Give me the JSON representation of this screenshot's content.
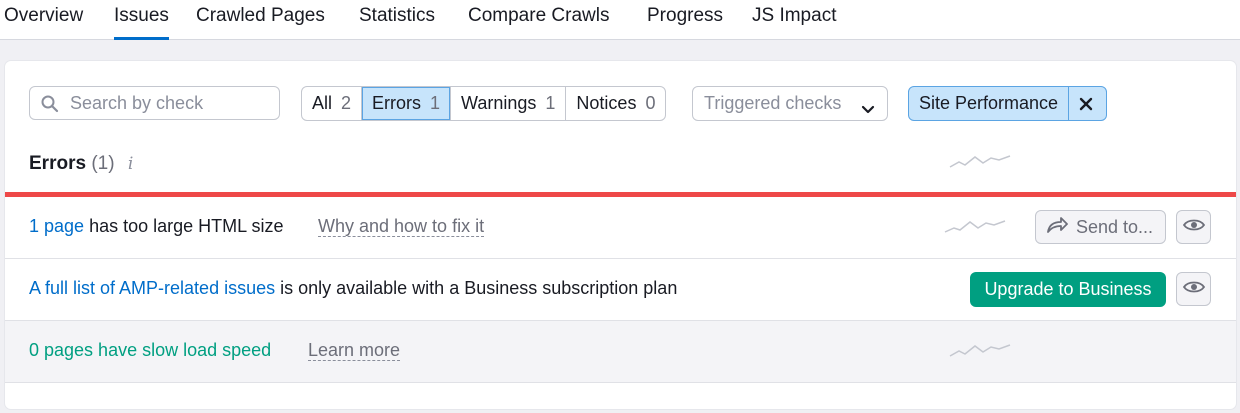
{
  "nav": {
    "tabs": [
      {
        "label": "Overview"
      },
      {
        "label": "Issues"
      },
      {
        "label": "Crawled Pages"
      },
      {
        "label": "Statistics"
      },
      {
        "label": "Compare Crawls"
      },
      {
        "label": "Progress"
      },
      {
        "label": "JS Impact"
      }
    ],
    "active": "Issues"
  },
  "filters": {
    "search_placeholder": "Search by check",
    "segments": [
      {
        "label": "All",
        "count": "2"
      },
      {
        "label": "Errors",
        "count": "1"
      },
      {
        "label": "Warnings",
        "count": "1"
      },
      {
        "label": "Notices",
        "count": "0"
      }
    ],
    "active_segment": "Errors",
    "dropdown_label": "Triggered checks",
    "chip_label": "Site Performance"
  },
  "section": {
    "title": "Errors",
    "count": "(1)",
    "info_glyph": "i"
  },
  "rows": [
    {
      "link": "1 page",
      "text": " has too large HTML size",
      "help": "Why and how to fix it",
      "action": "Send to..."
    },
    {
      "link": "A full list of AMP-related issues",
      "text": " is only available with a Business subscription plan",
      "action": "Upgrade to Business"
    },
    {
      "link": "0 pages have slow load speed",
      "help": "Learn more"
    }
  ],
  "colors": {
    "accent_blue": "#006dca",
    "error_red": "#ee4848",
    "success_green": "#009f81",
    "chip_bg": "#c7e4fb"
  },
  "icons": [
    "search-icon",
    "chevron-down-icon",
    "close-icon",
    "trend-sparkline-icon",
    "share-arrow-icon",
    "eye-icon"
  ]
}
